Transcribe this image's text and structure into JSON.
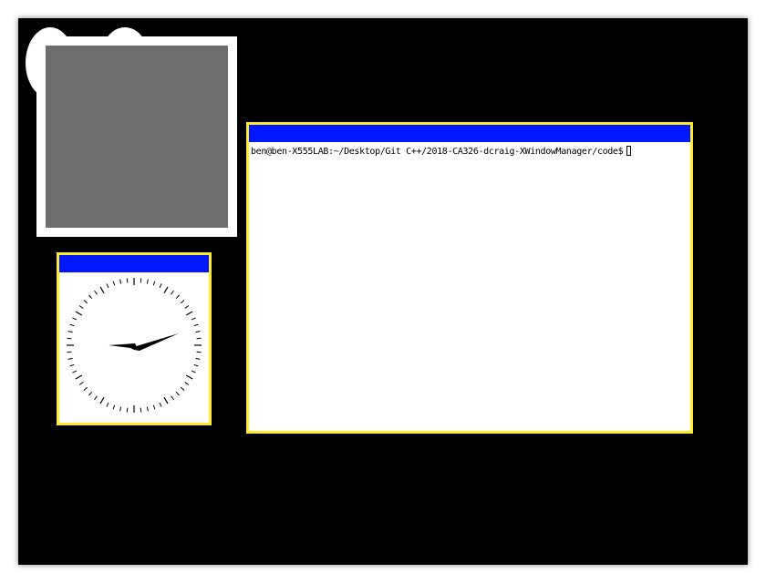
{
  "desktop": {
    "background_color": "#000000"
  },
  "windows": {
    "frame_border_color": "#ffea2e",
    "titlebar_color": "#0018ff",
    "gray_window": {
      "client_color": "#6e6e6e"
    },
    "clock": {
      "hour_hand_minutes_angle_hint": "hour-hand-icon",
      "hands_icon": "clock-hands-icon"
    },
    "terminal": {
      "prompt": "ben@ben-X555LAB:~/Desktop/Git C++/2018-CA326-dcraig-XWindowManager/code$"
    }
  }
}
